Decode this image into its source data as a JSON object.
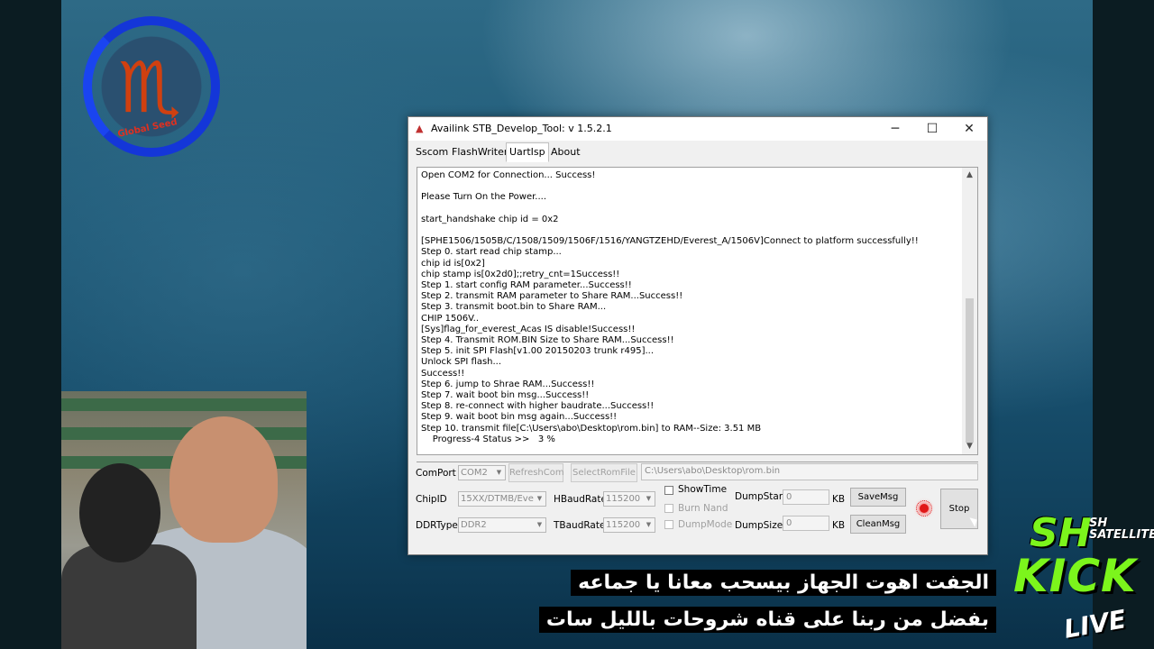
{
  "window": {
    "title": "Availink STB_Develop_Tool: v 1.5.2.1",
    "controls": {
      "minimize": "─",
      "maximize": "☐",
      "close": "✕"
    }
  },
  "tabs": [
    {
      "label": "Sscom",
      "active": false
    },
    {
      "label": "FlashWriter",
      "active": false
    },
    {
      "label": "UartIsp",
      "active": true
    },
    {
      "label": "About",
      "active": false
    }
  ],
  "log": "Open COM2 for Connection... Success!\n\nPlease Turn On the Power....\n\nstart_handshake chip id = 0x2\n\n[SPHE1506/1505B/C/1508/1509/1506F/1516/YANGTZEHD/Everest_A/1506V]Connect to platform successfully!!\nStep 0. start read chip stamp...\nchip id is[0x2]\nchip stamp is[0x2d0];;retry_cnt=1Success!!\nStep 1. start config RAM parameter...Success!!\nStep 2. transmit RAM parameter to Share RAM...Success!!\nStep 3. transmit boot.bin to Share RAM...\nCHIP 1506V..\n[Sys]flag_for_everest_Acas IS disable!Success!!\nStep 4. Transmit ROM.BIN Size to Share RAM...Success!!\nStep 5. init SPI Flash[v1.00 20150203 trunk r495]...\nUnlock SPI flash...\nSuccess!!\nStep 6. jump to Shrae RAM...Success!!\nStep 7. wait boot bin msg...Success!!\nStep 8. re-connect with higher baudrate...Success!!\nStep 9. wait boot bin msg again...Success!!\nStep 10. transmit file[C:\\Users\\abo\\Desktop\\rom.bin] to RAM--Size: 3.51 MB\n    Progress-4 Status >>   3 %",
  "controls": {
    "comport_label": "ComPort",
    "comport_value": "COM2",
    "refresh_label": "RefreshCom",
    "selectrom_label": "SelectRomFile",
    "rom_path": "C:\\Users\\abo\\Desktop\\rom.bin",
    "chipid_label": "ChipID",
    "chipid_value": "15XX/DTMB/Eve",
    "ddrtype_label": "DDRType",
    "ddrtype_value": "DDR2",
    "hbaud_label": "HBaudRate",
    "hbaud_value": "115200",
    "tbaud_label": "TBaudRate",
    "tbaud_value": "115200",
    "showtime_label": "ShowTime",
    "burnnand_label": "Burn Nand",
    "dumpmode_label": "DumpMode",
    "dumpstart_label": "DumpStart",
    "dumpstart_value": "0",
    "dumpsize_label": "DumpSize",
    "dumpsize_value": "0",
    "kb_unit": "KB",
    "savemsg_label": "SaveMsg",
    "cleanmsg_label": "CleanMsg",
    "stop_label": "Stop"
  },
  "overlay": {
    "logo_text": "Global Seed",
    "subtitle_line1": "الجفت اهوت الجهاز بيسحب معانا يا جماعه",
    "subtitle_line2": "بفضل من ربنا على قناه شروحات بالليل سات",
    "brand_sh": "SH",
    "brand_satellite_1": "SH",
    "brand_satellite_2": "SATELLITE",
    "brand_kick": "KICK",
    "brand_live": "LIVE"
  },
  "colors": {
    "accent_green": "#7cf51c",
    "logo_blue": "#1436d8",
    "led_red": "#e01818"
  }
}
